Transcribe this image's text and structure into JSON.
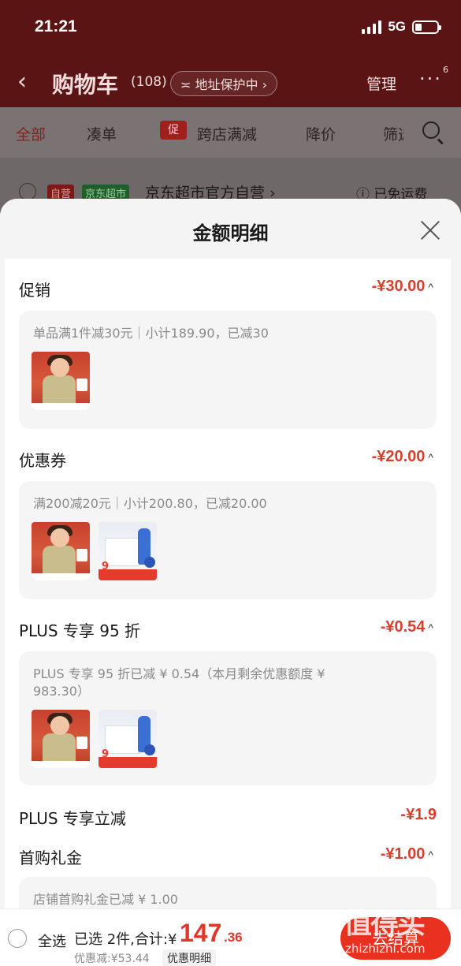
{
  "status_bar": {
    "time": "21:21",
    "network": "5G"
  },
  "nav": {
    "back_icon": "chevron-left-icon",
    "title": "购物车",
    "count": "(108)",
    "address": "≍ 地址保护中 ›",
    "manage": "管理",
    "more": "···",
    "badge": "6"
  },
  "filter_tabs": {
    "all": "全部",
    "bundle": "凑单",
    "promo_tag": "促",
    "cross_store": "跨店满减",
    "price_drop": "降价",
    "filter": "筛选"
  },
  "store": {
    "self_tag": "自营",
    "jd_tag": "京东超市",
    "name": "京东超市官方自营 ›",
    "shipping": "ⓘ 已免运费"
  },
  "sheet": {
    "title": "金额明细",
    "sections": [
      {
        "title": "促销",
        "amount": "-¥30.00",
        "chevron": "^",
        "desc": "单品满1件减30元｜小计189.90，已减30"
      },
      {
        "title": "优惠券",
        "amount": "-¥20.00",
        "chevron": "^",
        "desc": "满200减20元｜小计200.80，已减20.00"
      },
      {
        "title": "PLUS 专享 95 折",
        "amount": "-¥0.54",
        "chevron": "^",
        "desc": "PLUS 专享 95 折已减 ¥ 0.54（本月剩余优惠额度 ¥ 983.30）"
      },
      {
        "title": "PLUS 专享立减",
        "amount": "-¥1.9"
      },
      {
        "title": "首购礼金",
        "amount": "-¥1.00",
        "chevron": "^",
        "desc": "店铺首购礼金已减 ¥ 1.00"
      }
    ]
  },
  "bottom_bar": {
    "select_all": "全选",
    "selected": "已选 2件,合计:¥",
    "price_int": "147",
    "price_dec": ".36",
    "discount": "优惠减:¥53.44",
    "detail": "优惠明细",
    "checkout": "去结算"
  },
  "watermark": {
    "text": "值得买",
    "domain": "zhizhizhi.com"
  },
  "colors": {
    "accent": "#e0372b",
    "discount_red": "#d6402c",
    "header_dark": "#5a1414"
  }
}
